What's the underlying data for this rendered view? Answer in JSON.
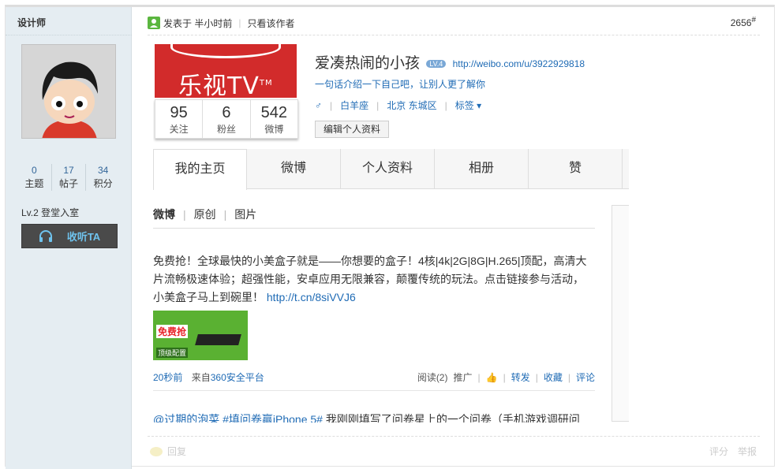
{
  "author": {
    "name": "设计师",
    "stats": [
      {
        "value": "0",
        "label": "主题"
      },
      {
        "value": "17",
        "label": "帖子"
      },
      {
        "value": "34",
        "label": "积分"
      }
    ],
    "level": "Lv.2 登堂入室",
    "follow_label": "收听TA"
  },
  "post_header": {
    "posted": "发表于 半小时前",
    "only_author": "只看该作者",
    "floor": "2656",
    "floor_mark": "#"
  },
  "weibo": {
    "banner_logo": "乐视TV",
    "banner_tm": "TM",
    "counts": [
      {
        "value": "95",
        "label": "关注"
      },
      {
        "value": "6",
        "label": "粉丝"
      },
      {
        "value": "542",
        "label": "微博"
      }
    ],
    "name": "爱凑热闹的小孩",
    "badge": "LV.4",
    "url": "http://weibo.com/u/3922929818",
    "intro": "一句话介绍一下自己吧，让别人更了解你",
    "gender": "♂",
    "constellation": "白羊座",
    "location": "北京 东城区",
    "tags_label": "标签",
    "edit_label": "编辑个人资料",
    "tabs": [
      "我的主页",
      "微博",
      "个人资料",
      "相册",
      "赞"
    ],
    "subtabs": [
      "微博",
      "原创",
      "图片"
    ],
    "post_text": "免费抢！全球最快的小美盒子就是——你想要的盒子！4核|4k|2G|8G|H.265|顶配，高清大片流畅极速体验；超强性能，安卓应用无限兼容，颠覆传统的玩法。点击链接参与活动，小美盒子马上到碗里！",
    "post_link": "http://t.cn/8siVVJ6",
    "thumb_red": "免费抢",
    "thumb_small": "顶级配置",
    "time": "20秒前",
    "source_prefix": "来自",
    "source": "360安全平台",
    "read": "阅读(2)",
    "promote": "推广",
    "repost": "转发",
    "fav": "收藏",
    "comment": "评论",
    "next_mentions": "@过期的泡菜 #填问卷赢iPhone 5#",
    "next_text": " 我刚刚填写了问卷星上的一个问卷（手机游戏调研问"
  },
  "footer": {
    "reply": "回复",
    "rate": "评分",
    "report": "举报"
  },
  "colors": {
    "sidebar_bg": "#e5edf2",
    "link": "#1f6bb5",
    "follow_btn": "#4a4a4a",
    "banner_red": "#d22b2b"
  }
}
